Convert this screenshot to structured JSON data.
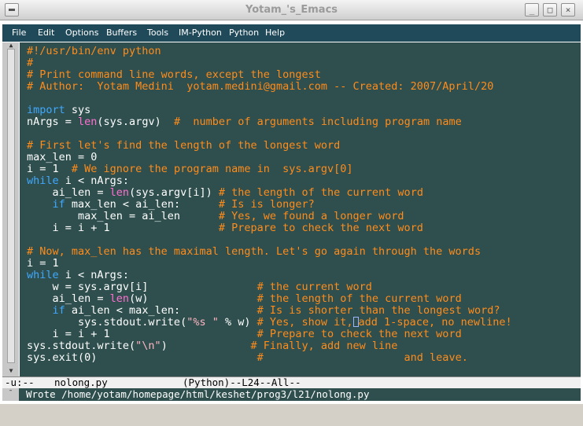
{
  "window": {
    "title": "Yotam_'s_Emacs"
  },
  "menubar": {
    "items": [
      "File",
      "Edit",
      "Options",
      "Buffers",
      "Tools",
      "IM-Python",
      "Python",
      "Help"
    ]
  },
  "editor": {
    "language": "python",
    "lines": [
      "#!/usr/bin/env python",
      "#",
      "# Print command line words, except the longest",
      "# Author:  Yotam Medini  yotam.medini@gmail.com -- Created: 2007/April/20",
      "",
      "import sys",
      "nArgs = len(sys.argv)  #  number of arguments including program name",
      "",
      "# First let's find the length of the longest word",
      "max_len = 0",
      "i = 1  # We ignore the program name in  sys.argv[0]",
      "while i < nArgs:",
      "    ai_len = len(sys.argv[i]) # the length of the current word",
      "    if max_len < ai_len:      # Is is longer?",
      "        max_len = ai_len      # Yes, we found a longer word",
      "    i = i + 1                 # Prepare to check the next word",
      "",
      "# Now, max_len has the maximal length. Let's go again through the words",
      "i = 1",
      "while i < nArgs:",
      "    w = sys.argv[i]                 # the current word",
      "    ai_len = len(w)                 # the length of the current word",
      "    if ai_len < max_len:            # Is is shorter than the longest word?",
      "        sys.stdout.write(\"%s \" % w) # Yes, show it, add 1-space, no newline!",
      "    i = i + 1                       # Prepare to check the next word",
      "sys.stdout.write(\"\\n\")             # Finally, add new line",
      "sys.exit(0)                         #                      and leave."
    ]
  },
  "modeline": {
    "status": "-u:--",
    "buffer_name": "nolong.py",
    "mode_info": "(Python)--L24--All--"
  },
  "minibuffer": {
    "message": "Wrote /home/yotam/homepage/html/keshet/prog3/l21/nolong.py"
  },
  "colors": {
    "editor_background": "#2f4f4f",
    "comment": "#ff8c1a",
    "keyword": "#3fa9ff",
    "builtin": "#ff6fd0",
    "string": "#ffb6c1",
    "menubar_background": "#204a5a"
  }
}
